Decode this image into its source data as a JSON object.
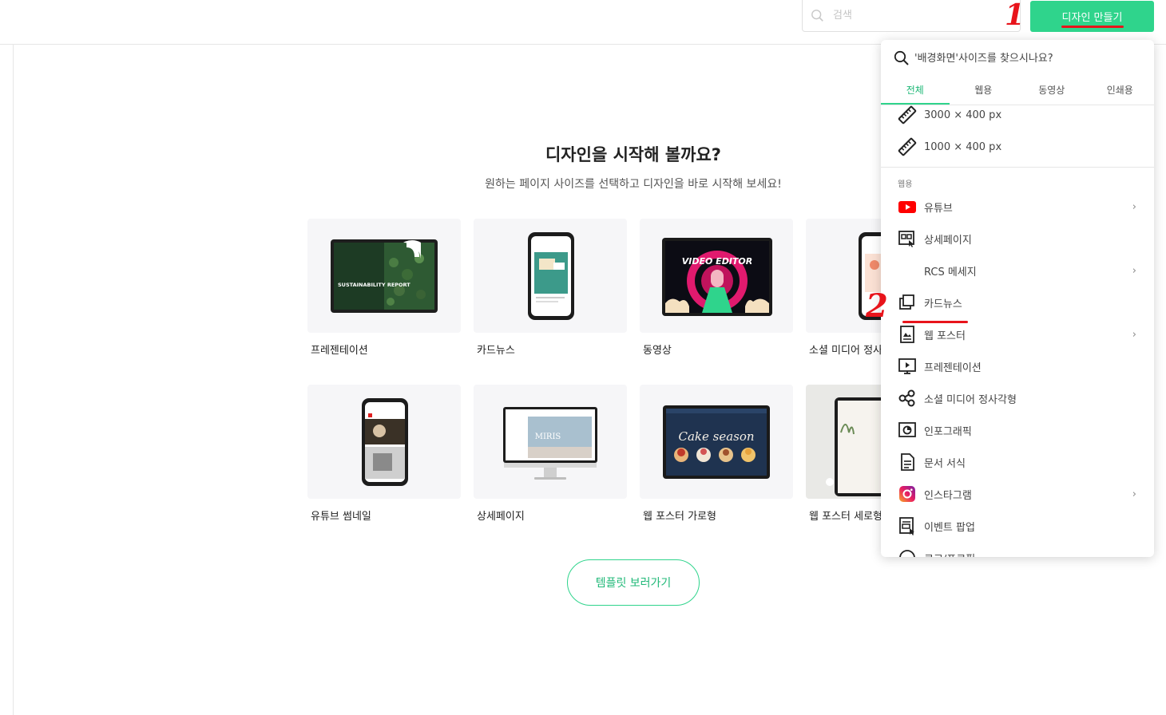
{
  "header": {
    "search_placeholder": "검색",
    "create_button": "디자인 만들기"
  },
  "main": {
    "title": "디자인을 시작해 볼까요?",
    "subtitle": "원하는 페이지 사이즈를 선택하고 디자인을 바로 시작해 보세요!",
    "cards": [
      {
        "label": "프레젠테이션",
        "thumb_text": "SUSTAINABILITY REPORT"
      },
      {
        "label": "카드뉴스"
      },
      {
        "label": "동영상",
        "thumb_text": "VIDEO EDITOR"
      },
      {
        "label": "소셜 미디어 정사"
      },
      {
        "label": "유튜브 썸네일"
      },
      {
        "label": "상세페이지",
        "thumb_text": "MIRIS"
      },
      {
        "label": "웹 포스터 가로형",
        "thumb_text": "Cake season"
      },
      {
        "label": "웹 포스터 세로형"
      }
    ],
    "template_button": "템플릿 보러가기"
  },
  "dropdown": {
    "search_placeholder": "'배경화면'사이즈를 찾으시나요?",
    "tabs": [
      "전체",
      "웹용",
      "동영상",
      "인쇄용"
    ],
    "recent": [
      "3000 × 400 px",
      "1000 × 400 px"
    ],
    "section_web": "웹용",
    "items": [
      {
        "label": "유튜브",
        "icon": "youtube-icon",
        "chevron": "›"
      },
      {
        "label": "상세페이지",
        "icon": "detail-page-icon",
        "chevron": ""
      },
      {
        "label": "RCS 메세지",
        "icon": "",
        "chevron": "›"
      },
      {
        "label": "카드뉴스",
        "icon": "card-news-icon",
        "chevron": ""
      },
      {
        "label": "웹 포스터",
        "icon": "web-poster-icon",
        "chevron": "›"
      },
      {
        "label": "프레젠테이션",
        "icon": "presentation-icon",
        "chevron": ""
      },
      {
        "label": "소셜 미디어 정사각형",
        "icon": "share-icon",
        "chevron": ""
      },
      {
        "label": "인포그래픽",
        "icon": "infographic-icon",
        "chevron": ""
      },
      {
        "label": "문서 서식",
        "icon": "document-icon",
        "chevron": ""
      },
      {
        "label": "인스타그램",
        "icon": "instagram-icon",
        "chevron": "›"
      },
      {
        "label": "이벤트 팝업",
        "icon": "event-popup-icon",
        "chevron": ""
      },
      {
        "label": "로고/프로필",
        "icon": "logo-icon",
        "chevron": ""
      }
    ]
  },
  "annotations": {
    "one": "1",
    "two": "2"
  },
  "colors": {
    "accent": "#2fd48c",
    "annotation": "#e8141b"
  }
}
